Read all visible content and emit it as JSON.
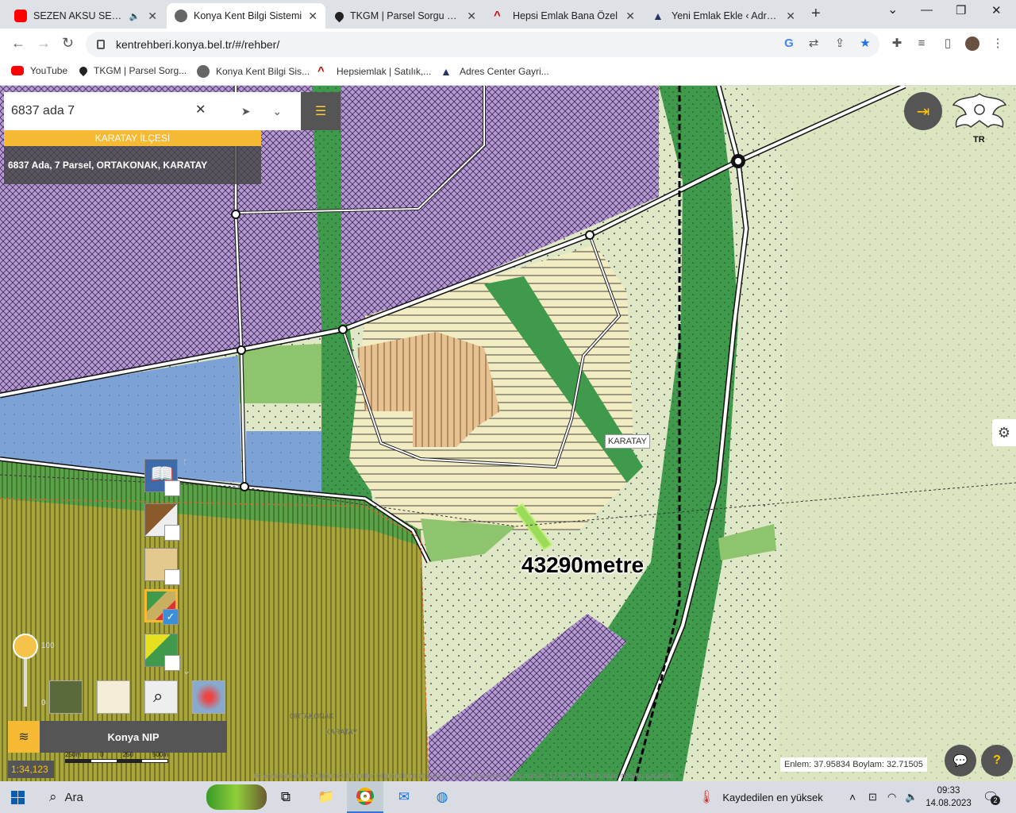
{
  "browser": {
    "tabs": [
      {
        "title": "SEZEN AKSU SEÇME Ş",
        "active": false
      },
      {
        "title": "Konya Kent Bilgi Sistemi",
        "active": true
      },
      {
        "title": "TKGM | Parsel Sorgu Uygu",
        "active": false
      },
      {
        "title": "Hepsi Emlak Bana Özel",
        "active": false
      },
      {
        "title": "Yeni Emlak Ekle ‹ Adres Ce",
        "active": false
      }
    ],
    "url": "kentrehberi.konya.bel.tr/#/rehber/",
    "bookmarks": [
      "YouTube",
      "TKGM | Parsel Sorg...",
      "Konya Kent Bilgi Sis...",
      "Hepsiemlak | Satılık,...",
      "Adres Center Gayri..."
    ]
  },
  "map_app": {
    "search_value": "6837 ada 7",
    "district": "KARATAY İLÇESİ",
    "parcel_result": "6837 Ada, 7 Parsel, ORTAKONAK, KARATAY",
    "emblem_text": "TR",
    "map_label_karatay": "KARATAY",
    "measurement": "43290metre",
    "label_ortakonak": "ORTAKONAK",
    "label_karatay_small": "KARATAY",
    "opacity_max": "100",
    "opacity_min": "0",
    "layer_panel_title": "Konya NIP",
    "scale": "1:34,123",
    "scale_ticks": [
      "250m",
      "0",
      "250",
      "500m"
    ],
    "coords": "Enlem: 37.95834 Boylam: 32.71505",
    "footer_note": "ile yararlanmakta olduğunuz hizmetler bilgilendirme amaçlıdır, resmi işlemlerde kullanılamaz. 17.05.2018 tarihinden itibaren geçerlidir."
  },
  "taskbar": {
    "search_placeholder": "Ara",
    "weather_text": "Kaydedilen en yüksek",
    "time": "09:33",
    "date": "14.08.2023",
    "notification_count": "2"
  },
  "colors": {
    "accent": "#f5b934",
    "dark_panel": "#555555",
    "residential_purple": "#b79ad6",
    "park_green": "#3f9a4c",
    "industrial_blue": "#7da2d6",
    "agri_olive": "#a8a53a"
  }
}
